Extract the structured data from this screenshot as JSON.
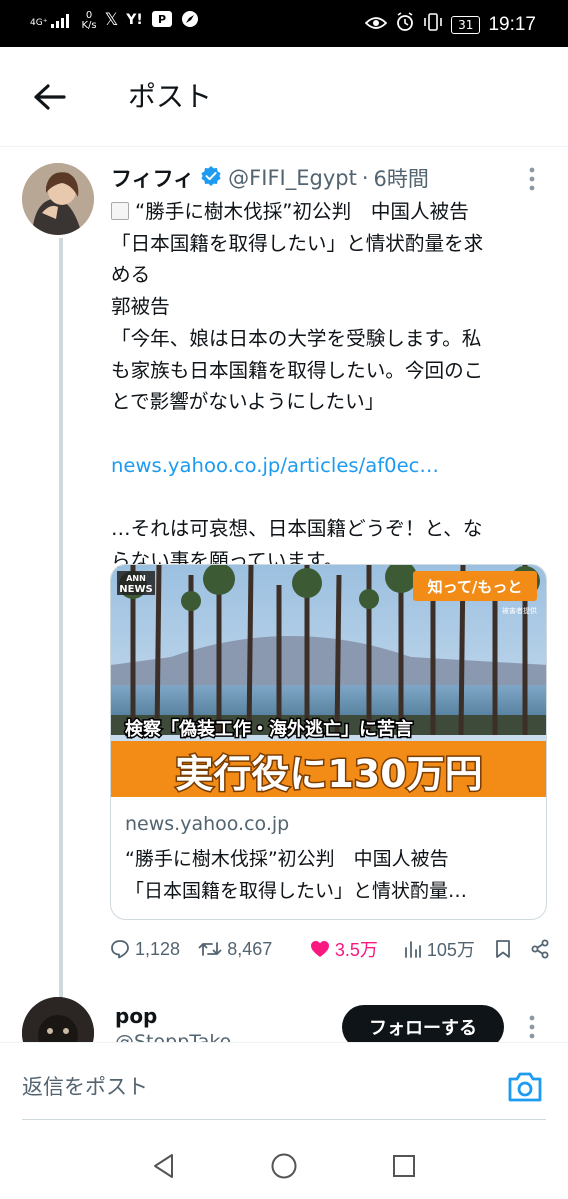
{
  "status_bar": {
    "network": "4G⁺",
    "speed_value": "0",
    "speed_unit": "K/s",
    "battery": "31",
    "time": "19:17"
  },
  "header": {
    "title": "ポスト"
  },
  "post": {
    "display_name": "フィフィ",
    "handle": "@FIFI_Egypt",
    "separator": "·",
    "time": "6時間",
    "lines": [
      "“勝手に樹木伐採”初公判　中国人被告",
      "「日本国籍を取得したい」と情状酌量を求",
      "める",
      "郭被告",
      "「今年、娘は日本の大学を受験します。私",
      "も家族も日本国籍を取得したい。今回のこ",
      "とで影響がないようにしたい」"
    ],
    "link": "news.yahoo.co.jp/articles/af0ec…",
    "closing_lines": [
      "…それは可哀想、日本国籍どうぞ！と、な",
      "らない事を願っています。"
    ]
  },
  "card": {
    "image": {
      "logo_top": "ANN",
      "logo_bottom": "NEWS",
      "badge": "知って/もっと",
      "credit": "被害者提供",
      "caption_small": "検察「偽装工作・海外逃亡」に苦言",
      "caption_large": "実行役に130万円"
    },
    "domain": "news.yahoo.co.jp",
    "title_line1": "“勝手に樹木伐採”初公判　中国人被告",
    "title_line2": "「日本国籍を取得したい」と情状酌量…"
  },
  "actions": {
    "replies": "1,128",
    "reposts": "8,467",
    "likes": "3.5万",
    "views": "105万"
  },
  "reply": {
    "name": "pop",
    "handle": "@StoppTako",
    "follow_label": "フォローする"
  },
  "compose": {
    "placeholder": "返信をポスト"
  },
  "colors": {
    "accent": "#1d9bf0",
    "like": "#f91880",
    "text": "#0f1419",
    "secondary": "#536471",
    "caption_orange": "#f28c17"
  }
}
